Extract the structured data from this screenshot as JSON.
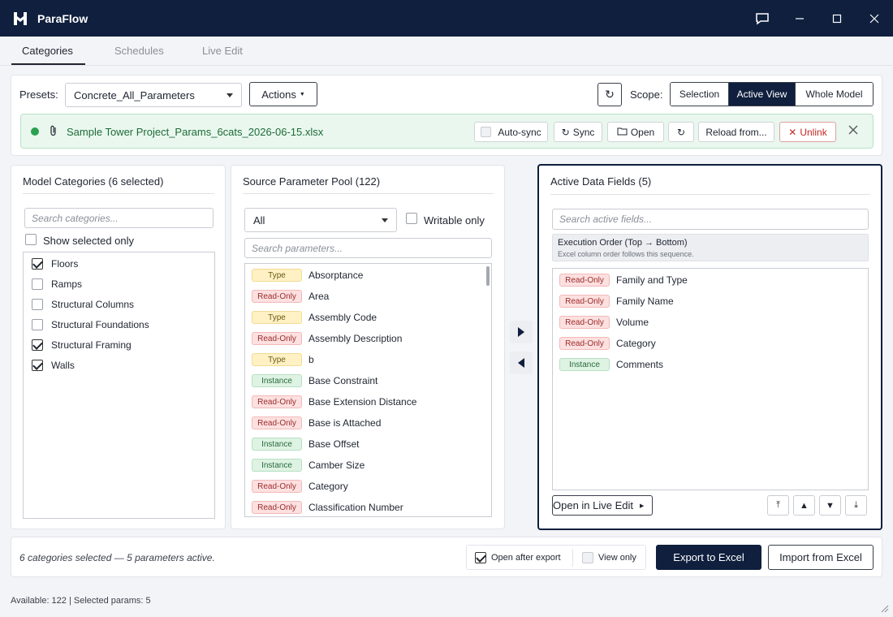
{
  "app": {
    "title": "ParaFlow"
  },
  "tabs": [
    {
      "label": "Categories",
      "active": true
    },
    {
      "label": "Schedules",
      "active": false
    },
    {
      "label": "Live Edit",
      "active": false
    }
  ],
  "toolbar": {
    "presets_label": "Presets:",
    "preset_value": "Concrete_All_Parameters",
    "actions_label": "Actions",
    "scope_label": "Scope:",
    "scope_options": [
      "Selection",
      "Active View",
      "Whole Model"
    ],
    "scope_active": "Active View"
  },
  "file_bar": {
    "file_name": "Sample Tower Project_Params_6cats_2026-06-15.xlsx",
    "auto_sync_label": "Auto-sync",
    "sync_label": "Sync",
    "open_label": "Open",
    "reload_label": "Reload from...",
    "unlink_label": "Unlink",
    "status_color": "#2aa050"
  },
  "categories_panel": {
    "title": "Model Categories (6 selected)",
    "search_placeholder": "Search categories...",
    "show_selected_label": "Show selected only",
    "items": [
      {
        "label": "Floors",
        "checked": true
      },
      {
        "label": "Ramps",
        "checked": false
      },
      {
        "label": "Structural Columns",
        "checked": false
      },
      {
        "label": "Structural Foundations",
        "checked": false
      },
      {
        "label": "Structural Framing",
        "checked": true
      },
      {
        "label": "Walls",
        "checked": true
      }
    ]
  },
  "pool_panel": {
    "title": "Source Parameter Pool (122)",
    "filter_value": "All",
    "writable_only_label": "Writable only",
    "search_placeholder": "Search parameters...",
    "items": [
      {
        "badge": "Type",
        "name": "Absorptance"
      },
      {
        "badge": "Read-Only",
        "name": "Area"
      },
      {
        "badge": "Type",
        "name": "Assembly Code"
      },
      {
        "badge": "Read-Only",
        "name": "Assembly Description"
      },
      {
        "badge": "Type",
        "name": "b"
      },
      {
        "badge": "Instance",
        "name": "Base Constraint"
      },
      {
        "badge": "Read-Only",
        "name": "Base Extension Distance"
      },
      {
        "badge": "Read-Only",
        "name": "Base is Attached"
      },
      {
        "badge": "Instance",
        "name": "Base Offset"
      },
      {
        "badge": "Instance",
        "name": "Camber Size"
      },
      {
        "badge": "Read-Only",
        "name": "Category"
      },
      {
        "badge": "Read-Only",
        "name": "Classification Number"
      }
    ]
  },
  "active_panel": {
    "title": "Active Data Fields (5)",
    "search_placeholder": "Search active fields...",
    "order_title": "Execution Order (Top → Bottom)",
    "order_sub": "Excel column order follows this sequence.",
    "items": [
      {
        "badge": "Read-Only",
        "name": "Family and Type"
      },
      {
        "badge": "Read-Only",
        "name": "Family Name"
      },
      {
        "badge": "Read-Only",
        "name": "Volume"
      },
      {
        "badge": "Read-Only",
        "name": "Category"
      },
      {
        "badge": "Instance",
        "name": "Comments"
      }
    ],
    "open_live_edit_label": "Open in Live Edit"
  },
  "bottom": {
    "summary": "6 categories selected — 5 parameters active.",
    "open_after_export_label": "Open after export",
    "open_after_export_checked": true,
    "view_only_label": "View only",
    "view_only_checked": false,
    "export_label": "Export to Excel",
    "import_label": "Import from Excel"
  },
  "status_bar": {
    "text": "Available: 122 | Selected params: 5"
  },
  "colors": {
    "navy": "#0f1f3d",
    "accent_green": "#2aa050"
  }
}
